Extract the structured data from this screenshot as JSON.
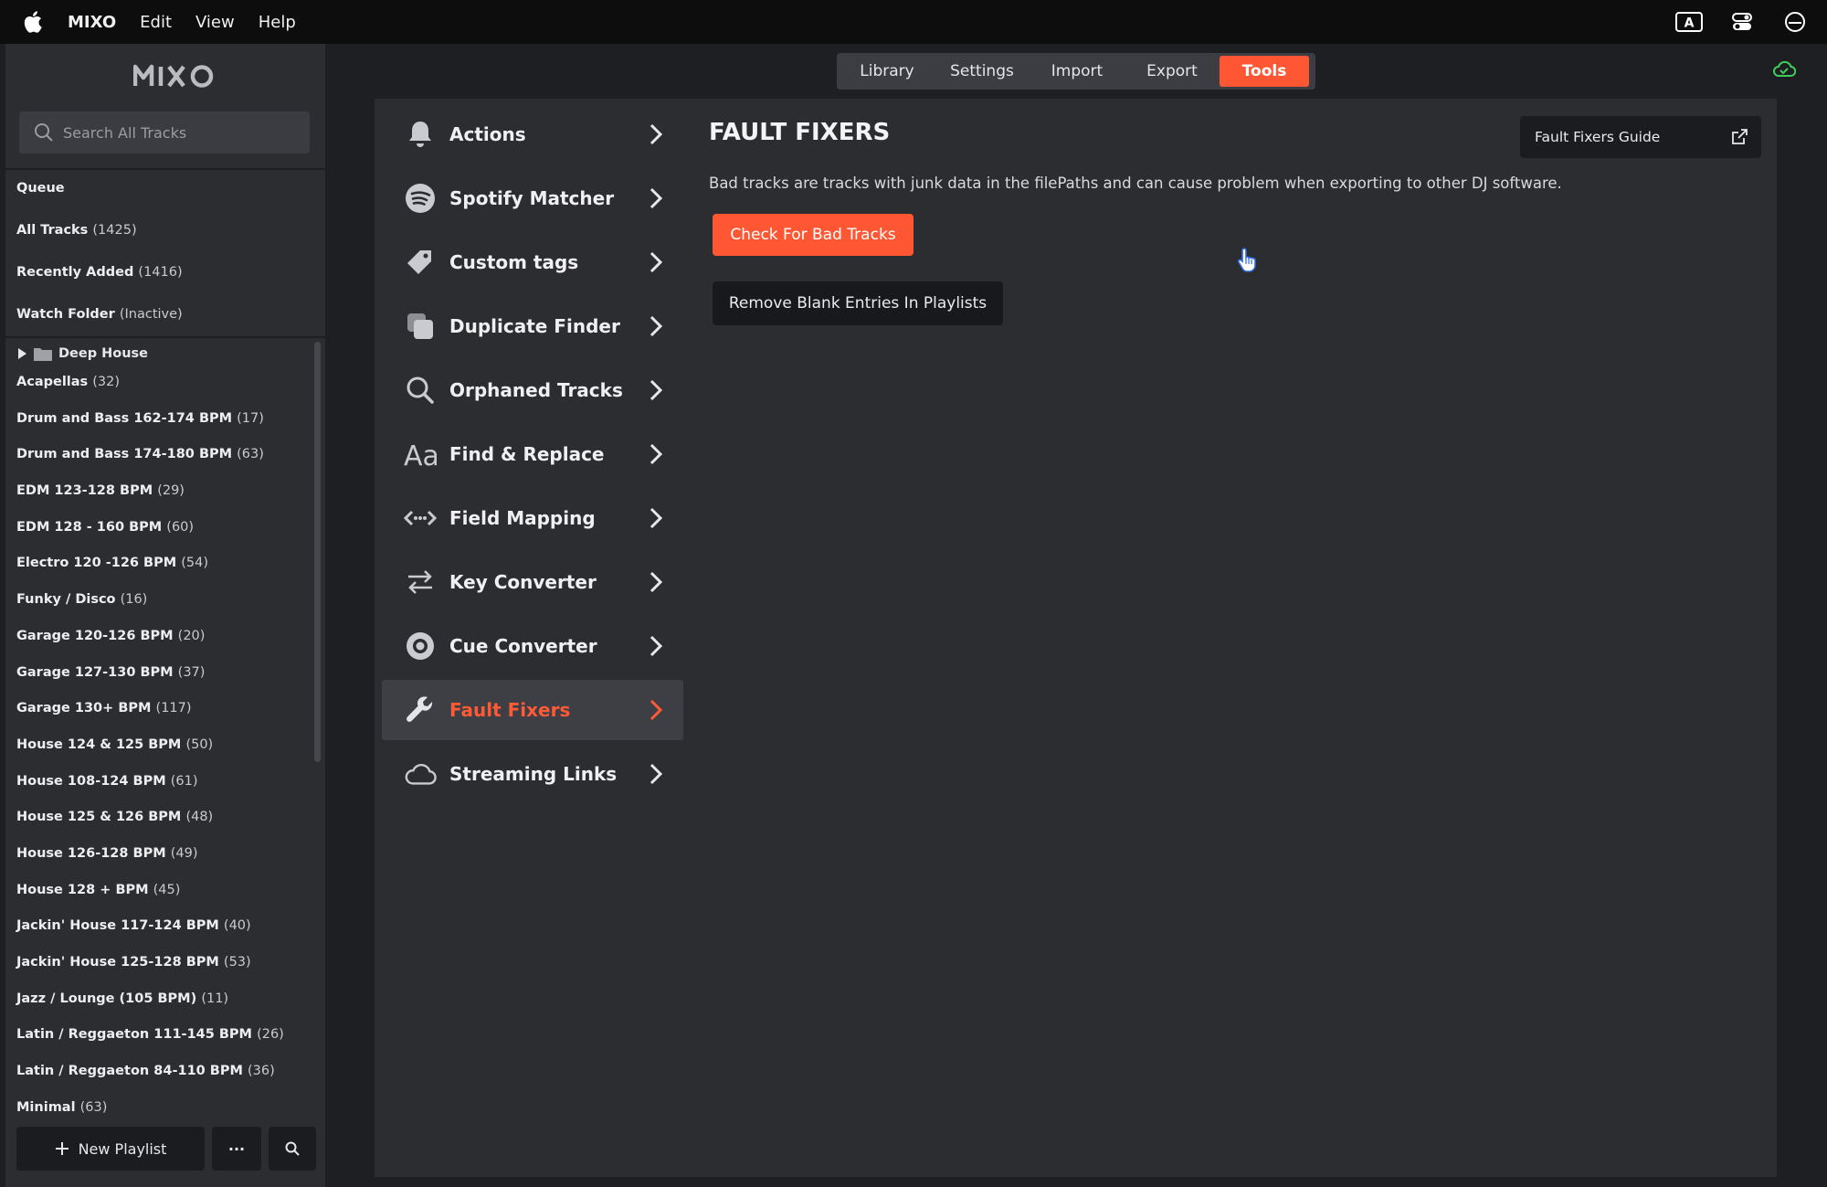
{
  "menubar": {
    "app_name": "MIXO",
    "items": [
      "Edit",
      "View",
      "Help"
    ],
    "right_icons": [
      "keyboard-a-icon",
      "control-center-icon",
      "status-circle-icon"
    ]
  },
  "sidebar": {
    "logo": "MIXO",
    "search_placeholder": "Search All Tracks",
    "library": [
      {
        "label": "Queue",
        "count": ""
      },
      {
        "label": "All Tracks",
        "count": "(1425)"
      },
      {
        "label": "Recently Added",
        "count": "(1416)"
      },
      {
        "label": "Watch Folder",
        "count": "(Inactive)"
      }
    ],
    "folder": "Deep House",
    "playlists": [
      {
        "label": "Acapellas",
        "count": "(32)"
      },
      {
        "label": "Drum and Bass 162-174 BPM",
        "count": "(17)"
      },
      {
        "label": "Drum and Bass 174-180 BPM",
        "count": "(63)"
      },
      {
        "label": "EDM 123-128 BPM",
        "count": "(29)"
      },
      {
        "label": "EDM 128 - 160 BPM",
        "count": "(60)"
      },
      {
        "label": "Electro 120 -126 BPM",
        "count": "(54)"
      },
      {
        "label": "Funky / Disco",
        "count": "(16)"
      },
      {
        "label": "Garage 120-126 BPM",
        "count": "(20)"
      },
      {
        "label": "Garage 127-130 BPM",
        "count": "(37)"
      },
      {
        "label": "Garage 130+ BPM",
        "count": "(117)"
      },
      {
        "label": "House 124 & 125 BPM",
        "count": "(50)"
      },
      {
        "label": "House 108-124 BPM",
        "count": "(61)"
      },
      {
        "label": "House 125 & 126 BPM",
        "count": "(48)"
      },
      {
        "label": "House 126-128 BPM",
        "count": "(49)"
      },
      {
        "label": "House 128 + BPM",
        "count": "(45)"
      },
      {
        "label": "Jackin' House 117-124 BPM",
        "count": "(40)"
      },
      {
        "label": "Jackin' House 125-128 BPM",
        "count": "(53)"
      },
      {
        "label": "Jazz / Lounge (105 BPM)",
        "count": "(11)"
      },
      {
        "label": "Latin / Reggaeton 111-145 BPM",
        "count": "(26)"
      },
      {
        "label": "Latin / Reggaeton 84-110 BPM",
        "count": "(36)"
      },
      {
        "label": "Minimal",
        "count": "(63)"
      }
    ],
    "new_playlist": "New Playlist",
    "more": "···"
  },
  "tabs": [
    "Library",
    "Settings",
    "Import",
    "Export",
    "Tools"
  ],
  "active_tab": "Tools",
  "tools": [
    {
      "label": "Actions",
      "icon": "bell-icon"
    },
    {
      "label": "Spotify Matcher",
      "icon": "spotify-icon"
    },
    {
      "label": "Custom tags",
      "icon": "tag-icon"
    },
    {
      "label": "Duplicate Finder",
      "icon": "duplicate-icon"
    },
    {
      "label": "Orphaned Tracks",
      "icon": "search-icon"
    },
    {
      "label": "Find & Replace",
      "icon": "font-icon"
    },
    {
      "label": "Field Mapping",
      "icon": "mapping-icon"
    },
    {
      "label": "Key Converter",
      "icon": "swap-icon"
    },
    {
      "label": "Cue Converter",
      "icon": "target-icon"
    },
    {
      "label": "Fault Fixers",
      "icon": "wrench-icon"
    },
    {
      "label": "Streaming Links",
      "icon": "cloud-icon"
    }
  ],
  "active_tool": "Fault Fixers",
  "content": {
    "title": "FAULT FIXERS",
    "description": "Bad tracks are tracks with junk data in the filePaths and can cause problem when exporting to other DJ software.",
    "check_button": "Check For Bad Tracks",
    "remove_button": "Remove Blank Entries In Playlists",
    "guide_button": "Fault Fixers Guide"
  },
  "colors": {
    "accent": "#ff5733",
    "sync_ok": "#3ecf5a"
  }
}
